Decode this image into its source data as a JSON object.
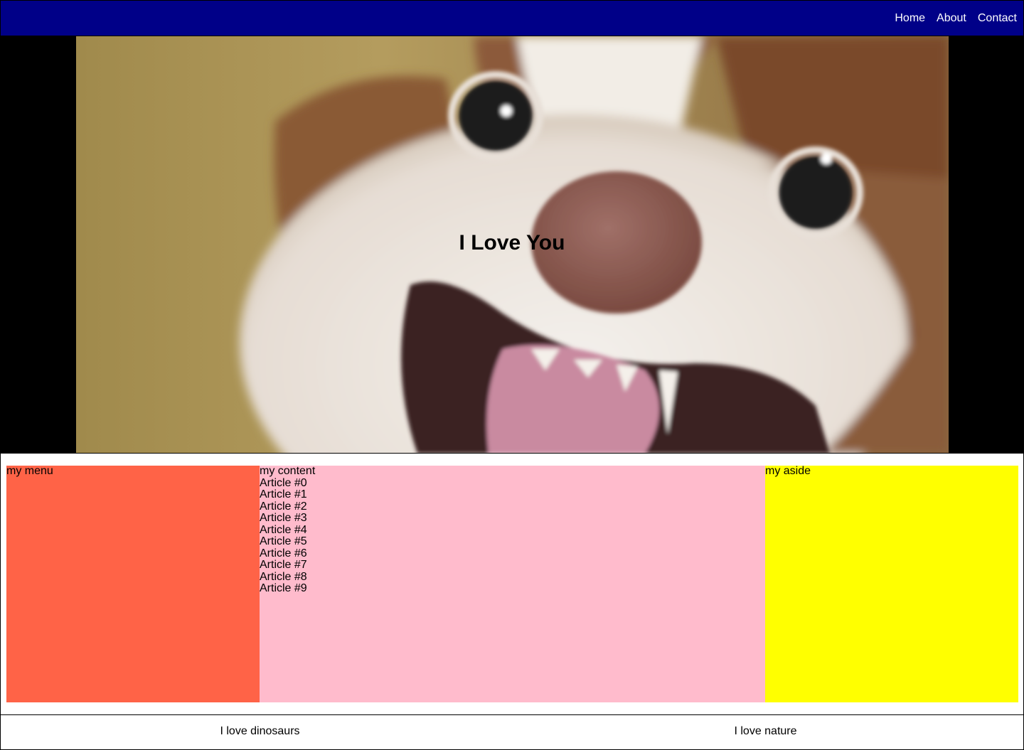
{
  "nav": {
    "links": [
      {
        "label": "Home"
      },
      {
        "label": "About"
      },
      {
        "label": "Contact"
      }
    ],
    "background": "#000088"
  },
  "hero": {
    "title": "I Love You",
    "image": "photo of a smiling brown-and-white dog close-up"
  },
  "main": {
    "menu": {
      "label": "my menu",
      "color": "#ff6347"
    },
    "content": {
      "label": "my content",
      "color": "#ffbbcc",
      "articles": [
        "Article #0",
        "Article #1",
        "Article #2",
        "Article #3",
        "Article #4",
        "Article #5",
        "Article #6",
        "Article #7",
        "Article #8",
        "Article #9"
      ]
    },
    "aside": {
      "label": "my aside",
      "color": "#ffff00"
    }
  },
  "footer": {
    "left": "I love dinosaurs",
    "right": "I love nature"
  }
}
